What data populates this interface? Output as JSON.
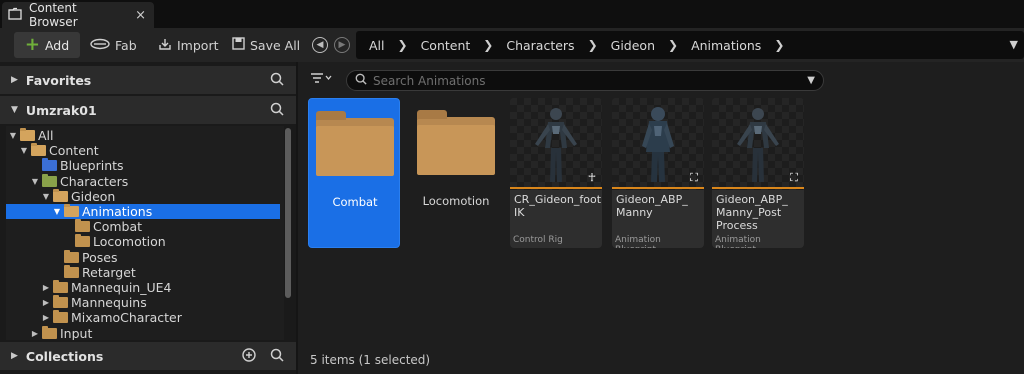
{
  "tab": {
    "title": "Content Browser",
    "close": "×"
  },
  "toolbar": {
    "add_label": "Add",
    "fab_label": "Fab",
    "import_label": "Import",
    "save_all_label": "Save All"
  },
  "breadcrumb": [
    "All",
    "Content",
    "Characters",
    "Gideon",
    "Animations"
  ],
  "left_panel": {
    "favorites_label": "Favorites",
    "project_label": "Umzrak01",
    "collections_label": "Collections",
    "tree": [
      {
        "label": "All",
        "depth": 0,
        "expanded": true,
        "color": "open"
      },
      {
        "label": "Content",
        "depth": 1,
        "expanded": true,
        "color": "open"
      },
      {
        "label": "Blueprints",
        "depth": 2,
        "expanded": null,
        "color": "blue"
      },
      {
        "label": "Characters",
        "depth": 2,
        "expanded": true,
        "color": "green"
      },
      {
        "label": "Gideon",
        "depth": 3,
        "expanded": true,
        "color": "open"
      },
      {
        "label": "Animations",
        "depth": 4,
        "expanded": true,
        "color": "open",
        "selected": true
      },
      {
        "label": "Combat",
        "depth": 5,
        "expanded": null,
        "color": "normal"
      },
      {
        "label": "Locomotion",
        "depth": 5,
        "expanded": null,
        "color": "normal"
      },
      {
        "label": "Poses",
        "depth": 4,
        "expanded": null,
        "color": "normal"
      },
      {
        "label": "Retarget",
        "depth": 4,
        "expanded": null,
        "color": "normal"
      },
      {
        "label": "Mannequin_UE4",
        "depth": 3,
        "expanded": false,
        "color": "normal"
      },
      {
        "label": "Mannequins",
        "depth": 3,
        "expanded": false,
        "color": "normal"
      },
      {
        "label": "MixamoCharacter",
        "depth": 3,
        "expanded": false,
        "color": "normal"
      },
      {
        "label": "Input",
        "depth": 2,
        "expanded": false,
        "color": "normal"
      }
    ]
  },
  "search": {
    "placeholder": "Search Animations",
    "value": ""
  },
  "items": [
    {
      "kind": "folder",
      "name": "Combat",
      "selected": true
    },
    {
      "kind": "folder",
      "name": "Locomotion",
      "selected": false
    },
    {
      "kind": "asset",
      "name": "CR_Gideon_foot IK",
      "type": "Control Rig",
      "badge": "figure-icon"
    },
    {
      "kind": "asset",
      "name": "Gideon_ABP_ Manny",
      "type": "Animation Blueprint",
      "badge": "run-icon"
    },
    {
      "kind": "asset",
      "name": "Gideon_ABP_ Manny_Post Process",
      "type": "Animation Blueprint",
      "badge": "run-icon"
    }
  ],
  "status": "5 items (1 selected)",
  "colors": {
    "accent": "#1a6fe6",
    "asset_bar": "#d9861b",
    "add_plus": "#6fb03a",
    "folder": "#c1924e"
  }
}
